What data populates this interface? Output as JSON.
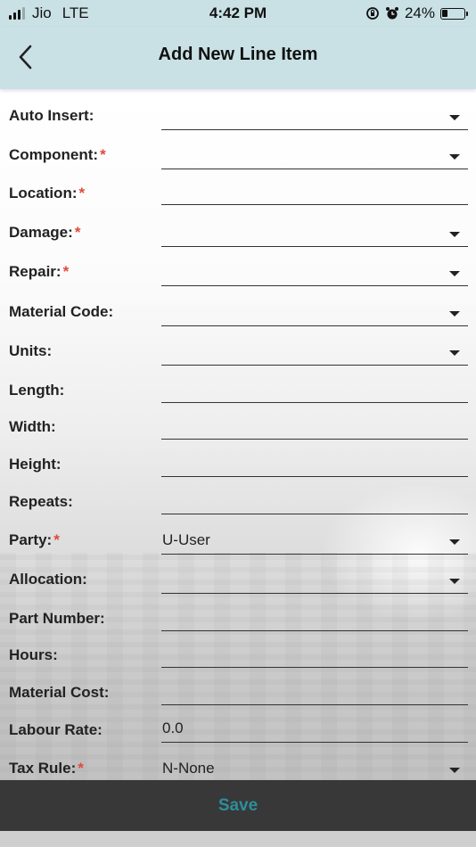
{
  "status_bar": {
    "carrier": "Jio",
    "network": "LTE",
    "time": "4:42 PM",
    "battery": "24%",
    "battery_level": 0.24
  },
  "nav": {
    "title": "Add New Line Item",
    "back_icon": "chevron-left-icon"
  },
  "fields": [
    {
      "label": "Auto Insert:",
      "required": false,
      "value": "",
      "dropdown": true
    },
    {
      "label": "Component:",
      "required": true,
      "value": "",
      "dropdown": true
    },
    {
      "label": "Location:",
      "required": true,
      "value": "",
      "dropdown": false
    },
    {
      "label": "Damage:",
      "required": true,
      "value": "",
      "dropdown": true
    },
    {
      "label": "Repair:",
      "required": true,
      "value": "",
      "dropdown": true
    },
    {
      "label": "Material Code:",
      "required": false,
      "value": "",
      "dropdown": true
    },
    {
      "label": "Units:",
      "required": false,
      "value": "",
      "dropdown": true
    },
    {
      "label": "Length:",
      "required": false,
      "value": "",
      "dropdown": false
    },
    {
      "label": "Width:",
      "required": false,
      "value": "",
      "dropdown": false
    },
    {
      "label": "Height:",
      "required": false,
      "value": "",
      "dropdown": false
    },
    {
      "label": "Repeats:",
      "required": false,
      "value": "",
      "dropdown": false
    },
    {
      "label": "Party:",
      "required": true,
      "value": "U-User",
      "dropdown": true
    },
    {
      "label": "Allocation:",
      "required": false,
      "value": "",
      "dropdown": true
    },
    {
      "label": "Part Number:",
      "required": false,
      "value": "",
      "dropdown": false
    },
    {
      "label": "Hours:",
      "required": false,
      "value": "",
      "dropdown": false
    },
    {
      "label": "Material Cost:",
      "required": false,
      "value": "",
      "dropdown": false
    },
    {
      "label": "Labour Rate:",
      "required": false,
      "value": "0.0",
      "dropdown": false
    },
    {
      "label": "Tax Rule:",
      "required": true,
      "value": "N-None",
      "dropdown": true
    }
  ],
  "required_marker": "*",
  "save_label": "Save",
  "colors": {
    "header_bg": "#c9e1e5",
    "required": "#e04a3a",
    "save_bar": "#383838",
    "save_text": "#2e8e9c"
  }
}
